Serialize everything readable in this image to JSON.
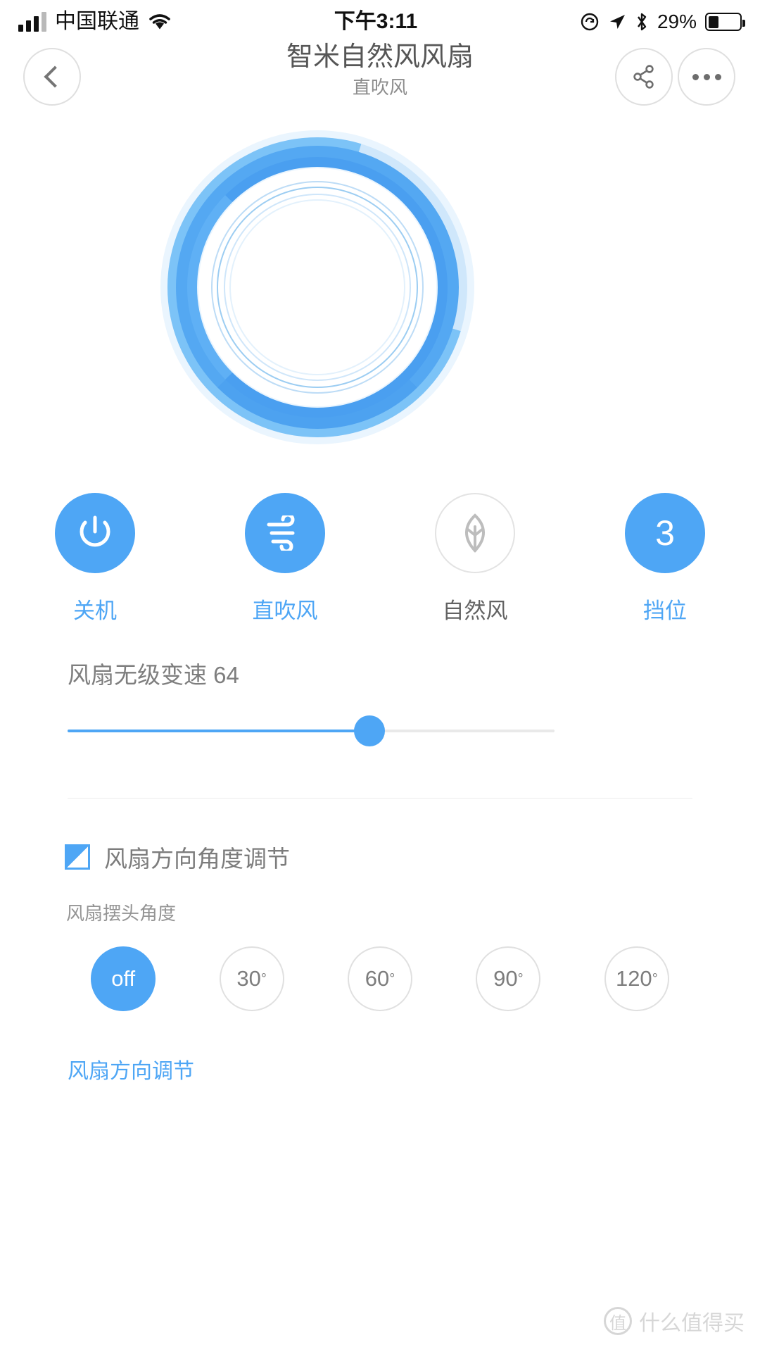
{
  "status_bar": {
    "carrier": "中国联通",
    "time": "下午3:11",
    "battery_percent": "29%",
    "icons": [
      "signal-bars-icon",
      "wifi-icon",
      "rotation-lock-icon",
      "location-arrow-icon",
      "bluetooth-icon",
      "battery-icon"
    ]
  },
  "nav": {
    "title": "智米自然风风扇",
    "subtitle": "直吹风",
    "back_icon": "chevron-left-icon",
    "share_icon": "share-icon",
    "more_icon": "ellipsis-icon"
  },
  "fan_visual": {
    "name": "fan-ring-visualization",
    "ring_color_outer": "#4ea6f5",
    "ring_color_light": "#7cc3f7",
    "ring_color_pale": "#cfe7fb",
    "ring_color_halo": "#eaf5fe"
  },
  "modes": [
    {
      "label": "关机",
      "icon": "power-icon",
      "active": true
    },
    {
      "label": "直吹风",
      "icon": "wind-icon",
      "active": true
    },
    {
      "label": "自然风",
      "icon": "leaf-icon",
      "active": false
    },
    {
      "label": "挡位",
      "icon": "gear-level-icon",
      "value": "3",
      "active": true
    }
  ],
  "speed": {
    "label": "风扇无级变速 64",
    "value": 64,
    "min": 0,
    "max": 100,
    "fill_percent": 62,
    "accent": "#4ea6f5"
  },
  "angle_section": {
    "icon": "angle-adjust-icon",
    "title": "风扇方向角度调节",
    "sub_label": "风扇摆头角度",
    "options": [
      {
        "label": "off",
        "selected": true
      },
      {
        "label": "30",
        "degree": "°",
        "selected": false
      },
      {
        "label": "60",
        "degree": "°",
        "selected": false
      },
      {
        "label": "90",
        "degree": "°",
        "selected": false
      },
      {
        "label": "120",
        "degree": "°",
        "selected": false
      }
    ],
    "bottom_link": "风扇方向调节"
  },
  "watermark": {
    "badge": "值",
    "text": "什么值得买"
  }
}
